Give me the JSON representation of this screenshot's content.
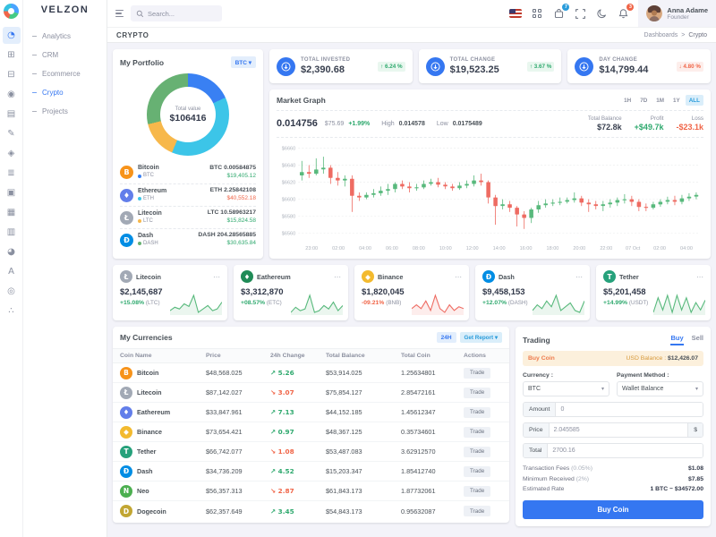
{
  "brand": {
    "name": "VELZON"
  },
  "topbar": {
    "search_placeholder": "Search...",
    "cart_badge": "7",
    "notification_badge": "3",
    "user": {
      "name": "Anna Adame",
      "role": "Founder"
    }
  },
  "page_header": {
    "title": "CRYPTO",
    "breadcrumb": [
      "Dashboards",
      "Crypto"
    ]
  },
  "sidebar": {
    "rail_icons": [
      {
        "name": "dashboards",
        "glyph": "◔",
        "active": true
      },
      {
        "name": "apps",
        "glyph": "⊞",
        "active": false
      },
      {
        "name": "layouts",
        "glyph": "⊟",
        "active": false
      },
      {
        "name": "authentication",
        "glyph": "◉",
        "active": false
      },
      {
        "name": "pages",
        "glyph": "▤",
        "active": false
      },
      {
        "name": "landing",
        "glyph": "✎",
        "active": false
      },
      {
        "name": "base-ui",
        "glyph": "◈",
        "active": false
      },
      {
        "name": "advance-ui",
        "glyph": "≣",
        "active": false
      },
      {
        "name": "widgets",
        "glyph": "▣",
        "active": false
      },
      {
        "name": "forms",
        "glyph": "▦",
        "active": false
      },
      {
        "name": "tables",
        "glyph": "▥",
        "active": false
      },
      {
        "name": "charts",
        "glyph": "◕",
        "active": false
      },
      {
        "name": "icons",
        "glyph": "A",
        "active": false
      },
      {
        "name": "maps",
        "glyph": "◎",
        "active": false
      },
      {
        "name": "multi-level",
        "glyph": "∴",
        "active": false
      }
    ],
    "items": [
      {
        "label": "Analytics",
        "active": false
      },
      {
        "label": "CRM",
        "active": false
      },
      {
        "label": "Ecommerce",
        "active": false
      },
      {
        "label": "Crypto",
        "active": true
      },
      {
        "label": "Projects",
        "active": false
      }
    ]
  },
  "portfolio": {
    "title": "My Portfolio",
    "currency_selector": "BTC",
    "total_label": "Total value",
    "total_value": "$106416",
    "coins": [
      {
        "name": "Bitcoin",
        "symbol": "BTC",
        "glyph": "B",
        "icon_color": "#f7931a",
        "dot_color": "#3980f3",
        "amount": "BTC 0.00584875",
        "value": "$19,405.12",
        "dir": "up"
      },
      {
        "name": "Ethereum",
        "symbol": "ETH",
        "glyph": "♦",
        "icon_color": "#627eea",
        "dot_color": "#3cc5e8",
        "amount": "ETH 2.25842108",
        "value": "$40,552.18",
        "dir": "down"
      },
      {
        "name": "Litecoin",
        "symbol": "LTC",
        "glyph": "Ł",
        "icon_color": "#a2a9b5",
        "dot_color": "#f7b84b",
        "amount": "LTC 10.58963217",
        "value": "$15,824.58",
        "dir": "up"
      },
      {
        "name": "Dash",
        "symbol": "DASH",
        "glyph": "Đ",
        "icon_color": "#008de4",
        "dot_color": "#67b173",
        "amount": "DASH 204.28565885",
        "value": "$30,635.84",
        "dir": "up"
      }
    ]
  },
  "summary_cards": [
    {
      "label": "TOTAL INVESTED",
      "value": "$2,390.68",
      "badge": "6.24 %",
      "dir": "up"
    },
    {
      "label": "TOTAL CHANGE",
      "value": "$19,523.25",
      "badge": "3.67 %",
      "dir": "up"
    },
    {
      "label": "DAY CHANGE",
      "value": "$14,799.44",
      "badge": "4.80 %",
      "dir": "down"
    }
  ],
  "market_graph": {
    "title": "Market Graph",
    "ranges": [
      "1H",
      "7D",
      "1M",
      "1Y",
      "ALL"
    ],
    "active_range": "ALL",
    "price": "0.014756",
    "price_usd": "$75.69",
    "price_change": "+1.99%",
    "high_label": "High",
    "high": "0.014578",
    "low_label": "Low",
    "low": "0.0175489",
    "stats": [
      {
        "label": "Total Balance",
        "value": "$72.8k",
        "tone": "dark"
      },
      {
        "label": "Profit",
        "value": "+$49.7k",
        "tone": "up"
      },
      {
        "label": "Loss",
        "value": "-$23.1k",
        "tone": "down"
      }
    ]
  },
  "coin_cards": [
    {
      "name": "Litecoin",
      "glyph": "Ł",
      "icon_color": "#a2a9b5",
      "value": "$2,145,687",
      "change": "+15.08%",
      "unit": "(LTC)",
      "dir": "up",
      "spark_id": "spark-litecoin"
    },
    {
      "name": "Eathereum",
      "glyph": "♦",
      "icon_color": "#208b57",
      "value": "$3,312,870",
      "change": "+08.57%",
      "unit": "(ETC)",
      "dir": "up",
      "spark_id": "spark-eathereum"
    },
    {
      "name": "Binance",
      "glyph": "◆",
      "icon_color": "#f3ba2f",
      "value": "$1,820,045",
      "change": "-09.21%",
      "unit": "(BNB)",
      "dir": "down",
      "spark_id": "spark-binance"
    },
    {
      "name": "Dash",
      "glyph": "Đ",
      "icon_color": "#008de4",
      "value": "$9,458,153",
      "change": "+12.07%",
      "unit": "(DASH)",
      "dir": "up",
      "spark_id": "spark-dash"
    },
    {
      "name": "Tether",
      "glyph": "T",
      "icon_color": "#26a17b",
      "value": "$5,201,458",
      "change": "+14.99%",
      "unit": "(USDT)",
      "dir": "up",
      "spark_id": "spark-tether"
    }
  ],
  "currencies": {
    "title": "My Currencies",
    "range_button": "24H",
    "report_button": "Get Report",
    "columns": [
      "Coin Name",
      "Price",
      "24h Change",
      "Total Balance",
      "Total Coin",
      "Actions"
    ],
    "action_label": "Trade",
    "rows": [
      {
        "coin": "Bitcoin",
        "glyph": "B",
        "icon_color": "#f7931a",
        "price": "$48,568.025",
        "change": "5.26",
        "dir": "up",
        "balance": "$53,914.025",
        "total_coin": "1.25634801"
      },
      {
        "coin": "Litecoin",
        "glyph": "Ł",
        "icon_color": "#a2a9b5",
        "price": "$87,142.027",
        "change": "3.07",
        "dir": "down",
        "balance": "$75,854.127",
        "total_coin": "2.85472161"
      },
      {
        "coin": "Eathereum",
        "glyph": "♦",
        "icon_color": "#627eea",
        "price": "$33,847.961",
        "change": "7.13",
        "dir": "up",
        "balance": "$44,152.185",
        "total_coin": "1.45612347"
      },
      {
        "coin": "Binance",
        "glyph": "◆",
        "icon_color": "#f3ba2f",
        "price": "$73,654.421",
        "change": "0.97",
        "dir": "up",
        "balance": "$48,367.125",
        "total_coin": "0.35734601"
      },
      {
        "coin": "Tether",
        "glyph": "T",
        "icon_color": "#26a17b",
        "price": "$66,742.077",
        "change": "1.08",
        "dir": "down",
        "balance": "$53,487.083",
        "total_coin": "3.62912570"
      },
      {
        "coin": "Dash",
        "glyph": "Đ",
        "icon_color": "#008de4",
        "price": "$34,736.209",
        "change": "4.52",
        "dir": "up",
        "balance": "$15,203.347",
        "total_coin": "1.85412740"
      },
      {
        "coin": "Neo",
        "glyph": "N",
        "icon_color": "#4caf50",
        "price": "$56,357.313",
        "change": "2.87",
        "dir": "down",
        "balance": "$61,843.173",
        "total_coin": "1.87732061"
      },
      {
        "coin": "Dogecoin",
        "glyph": "D",
        "icon_color": "#c2a633",
        "price": "$62,357.649",
        "change": "3.45",
        "dir": "up",
        "balance": "$54,843.173",
        "total_coin": "0.95632087"
      }
    ]
  },
  "trading": {
    "title": "Trading",
    "tabs": [
      "Buy",
      "Sell"
    ],
    "active_tab": "Buy",
    "banner": {
      "left": "Buy Coin",
      "right_label": "USD Balance :",
      "right_value": "$12,426.07"
    },
    "currency_label": "Currency :",
    "currency_value": "BTC",
    "payment_label": "Payment Method :",
    "payment_value": "Wallet Balance",
    "amount_label": "Amount",
    "amount_value": "0",
    "price_label": "Price",
    "price_value": "2.045585",
    "price_suffix": "$",
    "total_label": "Total",
    "total_value": "2700.16",
    "details": [
      {
        "label": "Transaction Fees",
        "sub": "(0.05%)",
        "value": "$1.08"
      },
      {
        "label": "Minimum Received",
        "sub": "(2%)",
        "value": "$7.85"
      },
      {
        "label": "Estimated Rate",
        "sub": "",
        "value": "1 BTC ~ $34572.00"
      }
    ],
    "submit_label": "Buy Coin"
  },
  "chart_data": [
    {
      "id": "market-candlestick",
      "type": "candlestick",
      "title": "Market Graph",
      "ylim": [
        6552,
        6668
      ],
      "y_ticks": [
        6560,
        6580,
        6600,
        6620,
        6640,
        6660
      ],
      "y_tick_labels": [
        "$6560",
        "$6580",
        "$6600",
        "$6620",
        "$6640",
        "$6660"
      ],
      "x_labels": [
        "23:00",
        "02:00",
        "04:00",
        "06:00",
        "08:00",
        "10:00",
        "12:00",
        "14:00",
        "16:00",
        "18:00",
        "20:00",
        "22:00",
        "07 Oct",
        "02:00",
        "04:00"
      ],
      "up_color": "#58b97c",
      "down_color": "#ee6b62",
      "candles": [
        [
          6628,
          6645,
          6622,
          6632
        ],
        [
          6632,
          6640,
          6625,
          6630
        ],
        [
          6630,
          6648,
          6628,
          6635
        ],
        [
          6635,
          6650,
          6630,
          6637
        ],
        [
          6637,
          6640,
          6618,
          6625
        ],
        [
          6625,
          6632,
          6616,
          6622
        ],
        [
          6622,
          6628,
          6615,
          6624
        ],
        [
          6624,
          6628,
          6585,
          6604
        ],
        [
          6604,
          6608,
          6598,
          6602
        ],
        [
          6602,
          6608,
          6600,
          6605
        ],
        [
          6605,
          6612,
          6602,
          6607
        ],
        [
          6607,
          6615,
          6604,
          6610
        ],
        [
          6610,
          6618,
          6605,
          6612
        ],
        [
          6612,
          6620,
          6608,
          6618
        ],
        [
          6618,
          6622,
          6612,
          6615
        ],
        [
          6615,
          6620,
          6608,
          6613
        ],
        [
          6613,
          6618,
          6610,
          6614
        ],
        [
          6614,
          6622,
          6612,
          6618
        ],
        [
          6618,
          6624,
          6616,
          6620
        ],
        [
          6620,
          6625,
          6614,
          6617
        ],
        [
          6617,
          6620,
          6612,
          6615
        ],
        [
          6615,
          6618,
          6610,
          6613
        ],
        [
          6613,
          6620,
          6611,
          6616
        ],
        [
          6616,
          6622,
          6613,
          6618
        ],
        [
          6618,
          6628,
          6615,
          6622
        ],
        [
          6622,
          6630,
          6616,
          6620
        ],
        [
          6620,
          6622,
          6595,
          6602
        ],
        [
          6602,
          6605,
          6570,
          6592
        ],
        [
          6592,
          6600,
          6588,
          6594
        ],
        [
          6594,
          6598,
          6585,
          6590
        ],
        [
          6590,
          6592,
          6568,
          6582
        ],
        [
          6582,
          6586,
          6565,
          6578
        ],
        [
          6578,
          6590,
          6572,
          6588
        ],
        [
          6588,
          6598,
          6584,
          6593
        ],
        [
          6593,
          6600,
          6590,
          6595
        ],
        [
          6595,
          6600,
          6592,
          6596
        ],
        [
          6596,
          6602,
          6593,
          6597
        ],
        [
          6597,
          6602,
          6595,
          6599
        ],
        [
          6599,
          6608,
          6596,
          6601
        ],
        [
          6601,
          6604,
          6592,
          6596
        ],
        [
          6596,
          6600,
          6585,
          6594
        ],
        [
          6594,
          6598,
          6588,
          6592
        ],
        [
          6592,
          6598,
          6586,
          6594
        ],
        [
          6594,
          6600,
          6590,
          6596
        ],
        [
          6596,
          6602,
          6592,
          6599
        ],
        [
          6599,
          6606,
          6595,
          6600
        ],
        [
          6600,
          6604,
          6592,
          6597
        ],
        [
          6597,
          6600,
          6586,
          6591
        ],
        [
          6591,
          6595,
          6586,
          6590
        ],
        [
          6590,
          6597,
          6588,
          6594
        ],
        [
          6594,
          6600,
          6591,
          6597
        ],
        [
          6597,
          6603,
          6594,
          6599
        ],
        [
          6599,
          6604,
          6593,
          6597
        ],
        [
          6597,
          6605,
          6594,
          6601
        ],
        [
          6601,
          6607,
          6598,
          6603
        ],
        [
          6603,
          6608,
          6600,
          6605
        ]
      ]
    },
    {
      "id": "portfolio-donut",
      "type": "pie",
      "title": "My Portfolio",
      "center_label": "Total value",
      "center_value": "$106416",
      "labels": [
        "Bitcoin",
        "Ethereum",
        "Litecoin",
        "Dash"
      ],
      "values": [
        19405.12,
        40552.18,
        15824.58,
        30635.84
      ],
      "colors": [
        "#3980f3",
        "#3cc5e8",
        "#f7b84b",
        "#67b173"
      ]
    },
    {
      "id": "spark-litecoin",
      "type": "line",
      "series_name": "Litecoin",
      "color": "#58b97c",
      "values": [
        10,
        14,
        12,
        18,
        15,
        28,
        8,
        12,
        16,
        10,
        12,
        20
      ]
    },
    {
      "id": "spark-eathereum",
      "type": "line",
      "series_name": "Eathereum",
      "color": "#58b97c",
      "values": [
        10,
        16,
        12,
        14,
        30,
        10,
        12,
        18,
        14,
        22,
        12,
        18
      ]
    },
    {
      "id": "spark-binance",
      "type": "line",
      "series_name": "Binance",
      "color": "#ee6b62",
      "values": [
        12,
        16,
        12,
        20,
        10,
        26,
        12,
        8,
        16,
        10,
        14,
        12
      ]
    },
    {
      "id": "spark-dash",
      "type": "line",
      "series_name": "Dash",
      "color": "#58b97c",
      "values": [
        12,
        18,
        14,
        22,
        16,
        28,
        12,
        16,
        20,
        12,
        10,
        22
      ]
    },
    {
      "id": "spark-tether",
      "type": "line",
      "series_name": "Tether",
      "color": "#58b97c",
      "values": [
        10,
        22,
        12,
        24,
        10,
        24,
        12,
        22,
        10,
        18,
        12,
        20
      ]
    }
  ]
}
